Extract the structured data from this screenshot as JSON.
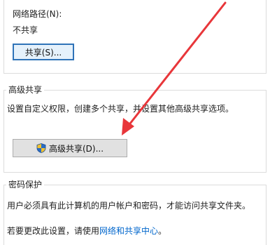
{
  "sharing": {
    "network_path_label": "网络路径(N):",
    "network_path_value": "不共享",
    "share_button_label": "共享(S)..."
  },
  "advanced_sharing": {
    "title": "高级共享",
    "description": "设置自定义权限，创建多个共享，并设置其他高级共享选项。",
    "button_label": "高级共享(D)..."
  },
  "password_protection": {
    "title": "密码保护",
    "description": "用户必须具有此计算机的用户帐户和密码，才能访问共享文件夹。",
    "change_prefix": "若要更改此设置，请使用",
    "change_link": "网络和共享中心",
    "change_suffix": "。"
  },
  "colors": {
    "annotation_arrow": "#e8363a",
    "link": "#0066cc",
    "focus_border": "#2f73b8"
  },
  "icons": {
    "advanced_button_icon": "uac-shield-icon",
    "annotation": "red-arrow-annotation"
  }
}
